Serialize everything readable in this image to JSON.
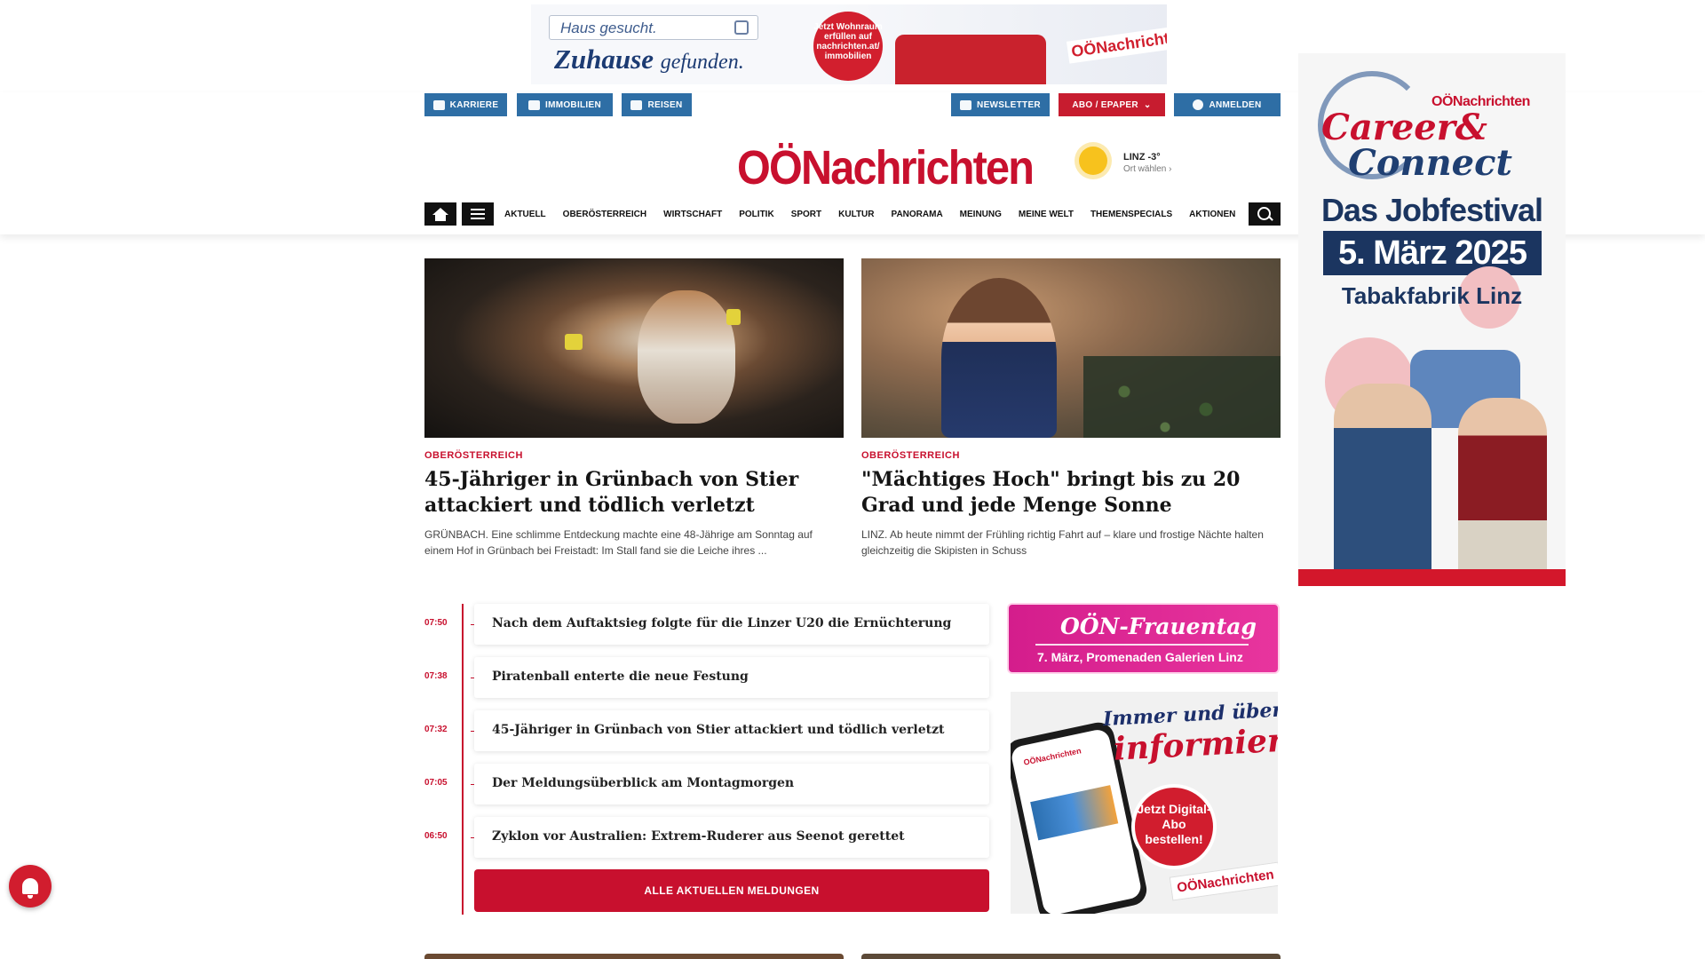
{
  "top_ad": {
    "search_placeholder": "Haus gesucht.",
    "slogan_main": "Zuhause",
    "slogan_sub": "gefunden.",
    "badge": "Jetzt Wohnraum erfüllen auf nachrichten.at/ immobilien",
    "brand": "OÖNachrichten"
  },
  "topbar": {
    "left": [
      "KARRIERE",
      "IMMOBILIEN",
      "REISEN"
    ],
    "newsletter": "NEWSLETTER",
    "abo": "ABO / EPAPER",
    "login": "ANMELDEN"
  },
  "logo": "OÖNachrichten",
  "weather": {
    "city": "LINZ -3°",
    "choose": "Ort wählen"
  },
  "nav": {
    "items": [
      "AKTUELL",
      "OBERÖSTERREICH",
      "WIRTSCHAFT",
      "POLITIK",
      "SPORT",
      "KULTUR",
      "PANORAMA",
      "MEINUNG",
      "MEINE WELT",
      "THEMENSPECIALS",
      "AKTIONEN"
    ]
  },
  "articles": [
    {
      "kicker": "OBERÖSTERREICH",
      "title": "45-Jähriger in Grünbach von Stier attackiert und tödlich verletzt",
      "teaser": "GRÜNBACH. Eine schlimme Entdeckung machte eine 48-Jährige am Sonntag auf einem Hof in Grünbach bei Freistadt: Im Stall fand sie die Leiche ihres ..."
    },
    {
      "kicker": "OBERÖSTERREICH",
      "title": "\"Mächtiges Hoch\" bringt bis zu 20 Grad und jede Menge Sonne",
      "teaser": "LINZ. Ab heute nimmt der Frühling richtig Fahrt auf – klare und frostige Nächte halten gleichzeitig die Skipisten in Schuss"
    }
  ],
  "timeline": [
    {
      "time": "07:50",
      "title": "Nach dem Auftaktsieg folgte für die Linzer U20 die Ernüchterung"
    },
    {
      "time": "07:38",
      "title": "Piratenball enterte die neue Festung"
    },
    {
      "time": "07:32",
      "title": "45-Jähriger in Grünbach von Stier attackiert und tödlich verletzt"
    },
    {
      "time": "07:05",
      "title": "Der Meldungsüberblick am Montagmorgen"
    },
    {
      "time": "06:50",
      "title": "Zyklon vor Australien: Extrem-Ruderer aus Seenot gerettet"
    }
  ],
  "all_news_button": "ALLE AKTUELLEN MELDUNGEN",
  "frauentag_ad": {
    "title": "OÖN-Frauentag",
    "subtitle": "7. März, Promenaden Galerien Linz"
  },
  "digital_ad": {
    "line1": "Immer und überall",
    "line2": "informiert.",
    "cta": "Jetzt Digital-Abo bestellen!",
    "brand": "OÖNachrichten",
    "screen_brand": "OÖNachrichten"
  },
  "side_ad": {
    "brand": "OÖNachrichten",
    "career": "Career&",
    "connect": "Connect",
    "festival": "Das Jobfestival",
    "date": "5. März 2025",
    "place": "Tabakfabrik Linz"
  },
  "colors": {
    "brand_red": "#c8102e",
    "topbar_blue": "#2e6ea5"
  }
}
